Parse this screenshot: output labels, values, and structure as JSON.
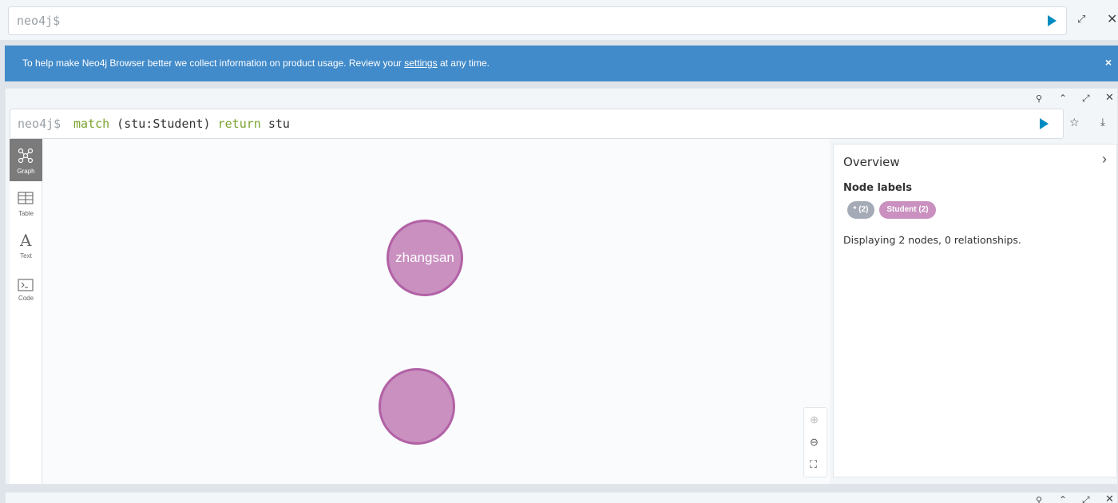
{
  "top_editor": {
    "prompt": "neo4j$"
  },
  "banner": {
    "message_before": "To help make Neo4j Browser better we collect information on product usage. Review your ",
    "link_text": "settings",
    "message_after": " at any time.",
    "close": "×"
  },
  "frame": {
    "prompt": "neo4j$",
    "query": {
      "kw_match": "match",
      "pattern": " (stu:Student) ",
      "kw_return": "return",
      "var": " stu"
    },
    "tabs": [
      {
        "label": "Graph",
        "icon": "graph-icon",
        "active": true
      },
      {
        "label": "Table",
        "icon": "table-icon",
        "active": false
      },
      {
        "label": "Text",
        "icon": "text-icon",
        "active": false
      },
      {
        "label": "Code",
        "icon": "code-icon",
        "active": false
      }
    ],
    "nodes": [
      {
        "caption": "zhangsan",
        "color": "#c990c0",
        "border": "#b261a5"
      },
      {
        "caption": "",
        "color": "#c990c0",
        "border": "#b261a5"
      }
    ]
  },
  "overview": {
    "title": "Overview",
    "node_labels_heading": "Node labels",
    "pills": [
      {
        "text": "* (2)",
        "color": "#a5abb6"
      },
      {
        "text": "Student (2)",
        "color": "#c990c0"
      }
    ],
    "description": "Displaying 2 nodes, 0 relationships."
  },
  "colors": {
    "accent": "#008cc1",
    "banner": "#428bca",
    "keyword": "#79a22e"
  }
}
